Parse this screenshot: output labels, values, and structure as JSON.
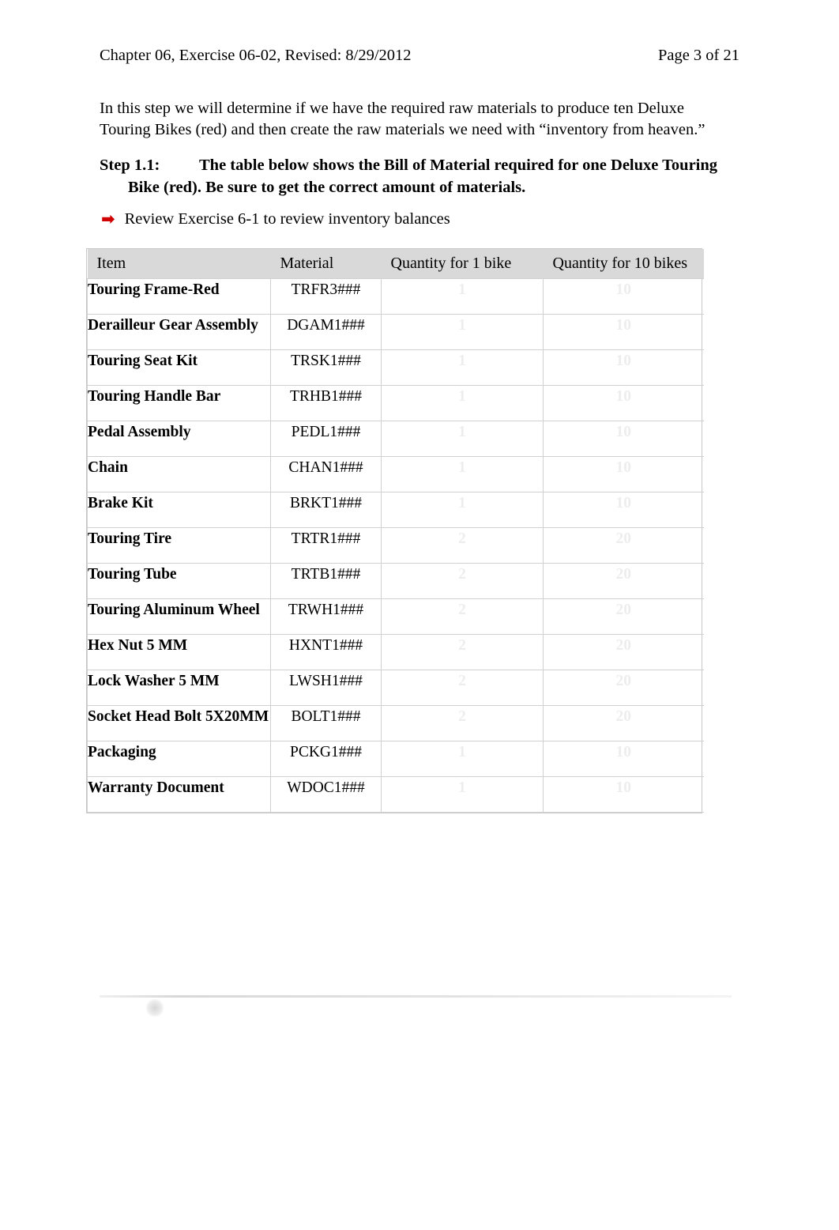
{
  "header": {
    "left": "Chapter 06, Exercise 06-02, Revised: 8/29/2012",
    "right": "Page 3 of 21"
  },
  "intro": {
    "text": "In this step we will determine if we have the required raw materials to produce ten Deluxe Touring Bikes (red) and then create the raw materials we need with “inventory from heaven.”"
  },
  "step": {
    "label": "Step 1.1:",
    "line1": "The table below shows the Bill of Material required for one Deluxe Touring",
    "line2": "Bike (red). Be sure to get the correct amount of materials."
  },
  "bullet": {
    "icon": "➡",
    "text": "Review Exercise 6-1 to review inventory balances"
  },
  "table": {
    "headers": [
      "Item",
      "Material",
      "Quantity for 1 bike",
      "Quantity for 10 bikes"
    ],
    "rows": [
      {
        "item": "Touring Frame-Red",
        "material": "TRFR3###",
        "q1": "1",
        "q10": "10"
      },
      {
        "item": "Derailleur Gear Assembly",
        "material": "DGAM1###",
        "q1": "1",
        "q10": "10"
      },
      {
        "item": "Touring Seat Kit",
        "material": "TRSK1###",
        "q1": "1",
        "q10": "10"
      },
      {
        "item": "Touring Handle Bar",
        "material": "TRHB1###",
        "q1": "1",
        "q10": "10"
      },
      {
        "item": "Pedal Assembly",
        "material": "PEDL1###",
        "q1": "1",
        "q10": "10"
      },
      {
        "item": "Chain",
        "material": "CHAN1###",
        "q1": "1",
        "q10": "10"
      },
      {
        "item": "Brake Kit",
        "material": "BRKT1###",
        "q1": "1",
        "q10": "10"
      },
      {
        "item": "Touring Tire",
        "material": "TRTR1###",
        "q1": "2",
        "q10": "20"
      },
      {
        "item": "Touring Tube",
        "material": "TRTB1###",
        "q1": "2",
        "q10": "20"
      },
      {
        "item": "Touring Aluminum Wheel",
        "material": "TRWH1###",
        "q1": "2",
        "q10": "20"
      },
      {
        "item": "Hex Nut 5 MM",
        "material": "HXNT1###",
        "q1": "2",
        "q10": "20"
      },
      {
        "item": "Lock Washer 5 MM",
        "material": "LWSH1###",
        "q1": "2",
        "q10": "20"
      },
      {
        "item": "Socket Head Bolt 5X20MM",
        "material": "BOLT1###",
        "q1": "2",
        "q10": "20"
      },
      {
        "item": "Packaging",
        "material": "PCKG1###",
        "q1": "1",
        "q10": "10"
      },
      {
        "item": "Warranty Document",
        "material": "WDOC1###",
        "q1": "1",
        "q10": "10"
      }
    ]
  },
  "colors": {
    "header_fill": "#d9d9d9",
    "arrow": "#d00000",
    "faded_text": "#ededed"
  }
}
